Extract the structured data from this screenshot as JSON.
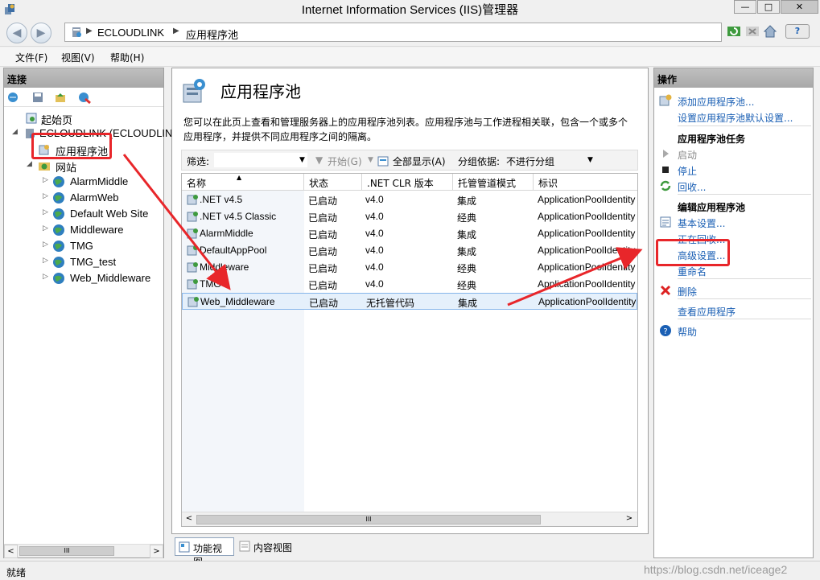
{
  "window": {
    "title": "Internet Information Services (IIS)管理器",
    "minimize": "—",
    "maximize": "□",
    "close": "✕"
  },
  "address": {
    "back_glyph": "◀",
    "forward_glyph": "▶",
    "breadcrumbs": [
      "ECLOUDLINK",
      "应用程序池"
    ],
    "separator": "▶",
    "help_glyph": "?"
  },
  "menu": [
    "文件(F)",
    "视图(V)",
    "帮助(H)"
  ],
  "connections": {
    "header": "连接",
    "tree": [
      {
        "label": "起始页",
        "level": 0,
        "expander": ""
      },
      {
        "label": "ECLOUDLINK (ECLOUDLIN",
        "level": 0,
        "expander": "◢"
      },
      {
        "label": "应用程序池",
        "level": 1,
        "expander": ""
      },
      {
        "label": "网站",
        "level": 1,
        "expander": "◢"
      },
      {
        "label": "AlarmMiddle",
        "level": 2,
        "expander": "▷"
      },
      {
        "label": "AlarmWeb",
        "level": 2,
        "expander": "▷"
      },
      {
        "label": "Default Web Site",
        "level": 2,
        "expander": "▷"
      },
      {
        "label": "Middleware",
        "level": 2,
        "expander": "▷"
      },
      {
        "label": "TMG",
        "level": 2,
        "expander": "▷"
      },
      {
        "label": "TMG_test",
        "level": 2,
        "expander": "▷"
      },
      {
        "label": "Web_Middleware",
        "level": 2,
        "expander": "▷"
      }
    ],
    "scroll_left": "<",
    "scroll_right": ">",
    "scroll_grip": "III"
  },
  "center": {
    "title": "应用程序池",
    "description": "您可以在此页上查看和管理服务器上的应用程序池列表。应用程序池与工作进程相关联，包含一个或多个应用程序，并提供不同应用程序之间的隔离。",
    "filter": {
      "filter_label": "筛选:",
      "start_label": "开始(G)",
      "show_all_label": "全部显示(A)",
      "group_by_label": "分组依据:",
      "group_by_value": "不进行分组"
    },
    "columns": [
      "名称",
      "状态",
      ".NET CLR 版本",
      "托管管道模式",
      "标识"
    ],
    "rows": [
      {
        "name": ".NET v4.5",
        "status": "已启动",
        "clr": "v4.0",
        "pipeline": "集成",
        "identity": "ApplicationPoolIdentity"
      },
      {
        "name": ".NET v4.5 Classic",
        "status": "已启动",
        "clr": "v4.0",
        "pipeline": "经典",
        "identity": "ApplicationPoolIdentity"
      },
      {
        "name": "AlarmMiddle",
        "status": "已启动",
        "clr": "v4.0",
        "pipeline": "集成",
        "identity": "ApplicationPoolIdentity"
      },
      {
        "name": "DefaultAppPool",
        "status": "已启动",
        "clr": "v4.0",
        "pipeline": "集成",
        "identity": "ApplicationPoolIdentity"
      },
      {
        "name": "Middleware",
        "status": "已启动",
        "clr": "v4.0",
        "pipeline": "经典",
        "identity": "ApplicationPoolIdentity"
      },
      {
        "name": "TMG",
        "status": "已启动",
        "clr": "v4.0",
        "pipeline": "经典",
        "identity": "ApplicationPoolIdentity"
      },
      {
        "name": "Web_Middleware",
        "status": "已启动",
        "clr": "无托管代码",
        "pipeline": "集成",
        "identity": "ApplicationPoolIdentity"
      }
    ],
    "selected_row": 6,
    "scroll_left": "<",
    "scroll_right": ">",
    "scroll_grip": "III"
  },
  "view_tabs": {
    "features": "功能视图",
    "content": "内容视图"
  },
  "actions": {
    "header": "操作",
    "items": [
      {
        "label": "添加应用程序池...",
        "type": "link",
        "icon": "add-pool-icon"
      },
      {
        "label": "设置应用程序池默认设置...",
        "type": "link",
        "icon": ""
      },
      {
        "label": "应用程序池任务",
        "type": "heading",
        "icon": ""
      },
      {
        "label": "启动",
        "type": "disabled",
        "icon": "start-icon"
      },
      {
        "label": "停止",
        "type": "link",
        "icon": "stop-icon"
      },
      {
        "label": "回收...",
        "type": "link",
        "icon": "recycle-icon"
      },
      {
        "label": "编辑应用程序池",
        "type": "heading",
        "icon": ""
      },
      {
        "label": "基本设置...",
        "type": "link",
        "icon": "basic-settings-icon"
      },
      {
        "label": "正在回收...",
        "type": "link",
        "icon": ""
      },
      {
        "label": "高级设置...",
        "type": "link",
        "icon": ""
      },
      {
        "label": "重命名",
        "type": "link",
        "icon": ""
      },
      {
        "label": "删除",
        "type": "link",
        "icon": "delete-icon"
      },
      {
        "label": "查看应用程序",
        "type": "link",
        "icon": ""
      },
      {
        "label": "帮助",
        "type": "link",
        "icon": "help-icon"
      }
    ]
  },
  "status": {
    "text": "就绪",
    "watermark": "https://blog.csdn.net/iceage2"
  },
  "colors": {
    "link": "#1a5fb4",
    "annotation": "#e8262a",
    "selection": "#e5f0fb"
  }
}
